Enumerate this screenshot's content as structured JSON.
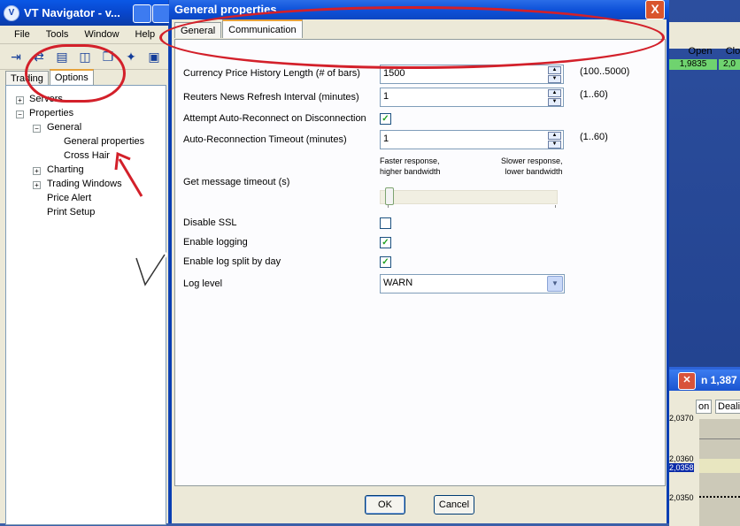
{
  "background": {
    "table_headers": [
      "Open",
      "Clo"
    ],
    "table_values": [
      "1,9835",
      "2,0"
    ],
    "chart_window_title": "n 1,387",
    "chart_tabs": [
      "on",
      "Dealir"
    ],
    "price_labels": [
      "2,0370",
      "2,0360",
      "2,0358",
      "2,0350"
    ]
  },
  "navigator": {
    "title": "VT Navigator - v...",
    "menu": [
      "File",
      "Tools",
      "Window",
      "Help"
    ],
    "tabs": [
      "Trading",
      "Options"
    ],
    "tree": {
      "servers": "Servers",
      "properties": "Properties",
      "general": "General",
      "general_properties": "General properties",
      "cross_hair": "Cross Hair",
      "charting": "Charting",
      "trading_windows": "Trading Windows",
      "price_alert": "Price Alert",
      "print_setup": "Print Setup"
    }
  },
  "dialog": {
    "title": "General properties",
    "close_label": "X",
    "tabs": [
      "General",
      "Communication"
    ],
    "fields": {
      "history_label": "Currency Price History Length (# of bars)",
      "history_value": "1500",
      "history_range": "(100..5000)",
      "news_label": "Reuters News Refresh Interval (minutes)",
      "news_value": "1",
      "news_range": "(1..60)",
      "reconnect_label": "Attempt Auto-Reconnect on Disconnection",
      "reconnect_timeout_label": "Auto-Reconnection Timeout (minutes)",
      "reconnect_timeout_value": "1",
      "reconnect_timeout_range": "(1..60)",
      "timeout_label": "Get message timeout (s)",
      "slider_left_note_1": "Faster response,",
      "slider_left_note_2": "higher bandwidth",
      "slider_right_note_1": "Slower response,",
      "slider_right_note_2": "lower bandwidth",
      "disable_ssl_label": "Disable SSL",
      "enable_logging_label": "Enable logging",
      "log_split_label": "Enable log split by day",
      "log_level_label": "Log level",
      "log_level_value": "WARN"
    },
    "checks": {
      "reconnect": true,
      "disable_ssl": false,
      "enable_logging": true,
      "log_split": true
    },
    "slider_level": 0,
    "ok_label": "OK",
    "cancel_label": "Cancel"
  },
  "colors": {
    "title_blue": "#0a58e6",
    "annotation_red": "#d3202a",
    "check_green": "#21a121"
  }
}
